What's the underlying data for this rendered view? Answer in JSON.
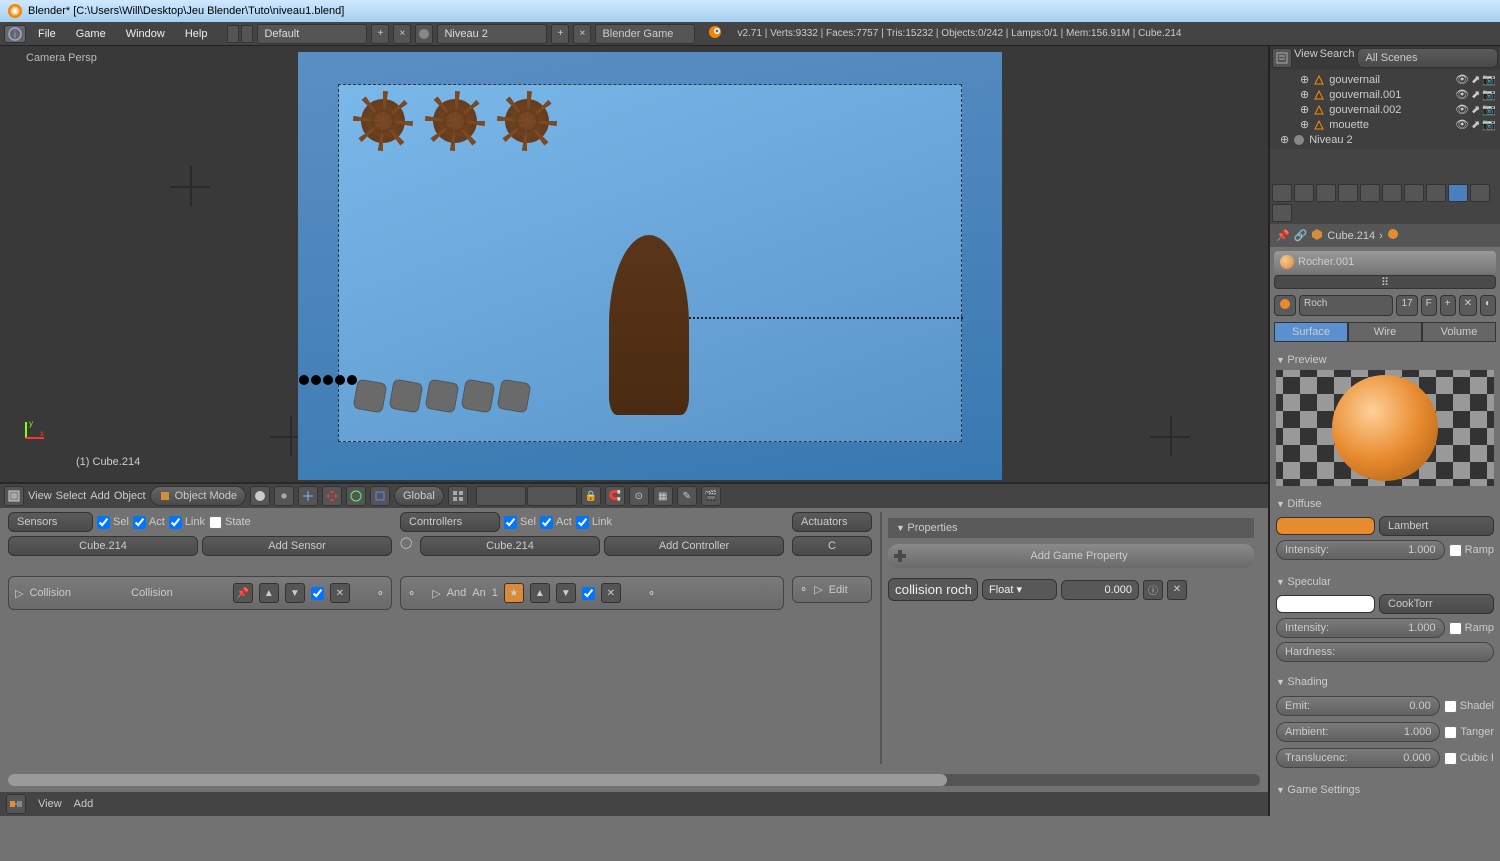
{
  "titlebar": {
    "title": "Blender* [C:\\Users\\Will\\Desktop\\Jeu Blender\\Tuto\\niveau1.blend]"
  },
  "topbar": {
    "menus": {
      "file": "File",
      "game": "Game",
      "window": "Window",
      "help": "Help"
    },
    "layout": "Default",
    "scene": "Niveau 2",
    "engine": "Blender Game",
    "stats": "v2.71 | Verts:9332 | Faces:7757 | Tris:15232 | Objects:0/242 | Lamps:0/1 | Mem:156.91M | Cube.214"
  },
  "viewport": {
    "camera_label": "Camera Persp",
    "object_label": "(1) Cube.214"
  },
  "view_header": {
    "menus": {
      "view": "View",
      "select": "Select",
      "add": "Add",
      "object": "Object"
    },
    "mode": "Object Mode",
    "orientation": "Global"
  },
  "logic": {
    "sensors": {
      "label": "Sensors",
      "sel": "Sel",
      "act": "Act",
      "link": "Link",
      "state": "State",
      "object": "Cube.214",
      "add": "Add Sensor",
      "brick": {
        "type": "Collision",
        "name": "Collision"
      }
    },
    "controllers": {
      "label": "Controllers",
      "sel": "Sel",
      "act": "Act",
      "link": "Link",
      "object": "Cube.214",
      "add": "Add Controller",
      "brick": {
        "type": "And",
        "name": "An",
        "state": "1"
      }
    },
    "actuators": {
      "label": "Actuators",
      "brick": {
        "name": "Edit"
      }
    },
    "panel": {
      "title": "Properties",
      "add": "Add Game Property",
      "row": {
        "name": "collision rocher",
        "type": "Float",
        "value": "0.000"
      }
    }
  },
  "bottom": {
    "view": "View",
    "add": "Add"
  },
  "outliner": {
    "view": "View",
    "search": "Search",
    "filter": "All Scenes",
    "items": {
      "gouvernail": "gouvernail",
      "gouvernail001": "gouvernail.001",
      "gouvernail002": "gouvernail.002",
      "mouette": "mouette",
      "niveau2": "Niveau 2"
    }
  },
  "properties": {
    "breadcrumb": "Cube.214",
    "material": {
      "name": "Rocher.001",
      "browse": "Roch",
      "users": "17",
      "fake": "F"
    },
    "tabs": {
      "surface": "Surface",
      "wire": "Wire",
      "volume": "Volume"
    },
    "preview_label": "Preview",
    "diffuse": {
      "label": "Diffuse",
      "shader": "Lambert",
      "intensity_label": "Intensity:",
      "intensity": "1.000",
      "ramp": "Ramp"
    },
    "specular": {
      "label": "Specular",
      "shader": "CookTorr",
      "intensity_label": "Intensity:",
      "intensity": "1.000",
      "ramp": "Ramp",
      "hardness": "Hardness:"
    },
    "shading": {
      "label": "Shading",
      "emit_label": "Emit:",
      "emit": "0.00",
      "ambient_label": "Ambient:",
      "ambient": "1.000",
      "transluc_label": "Translucenc:",
      "transluc": "0.000",
      "shadeless": "Shadel",
      "tangent": "Tanger",
      "cubic": "Cubic I"
    },
    "game_settings": "Game Settings"
  }
}
